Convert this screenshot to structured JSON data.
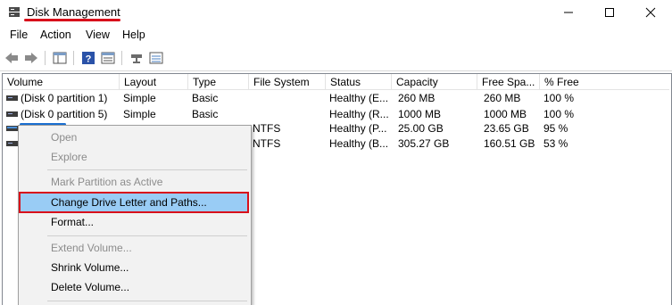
{
  "window": {
    "title": "Disk Management",
    "icon": "disk-management-icon",
    "controls": [
      "minimize-icon",
      "maximize-icon",
      "close-icon"
    ]
  },
  "menu": [
    "File",
    "Action",
    "View",
    "Help"
  ],
  "toolbar": [
    "back-arrow-icon",
    "forward-arrow-icon",
    "console-view-icon",
    "help-icon",
    "properties-view-icon",
    "connect-icon",
    "list-view-icon"
  ],
  "table": {
    "columns": [
      "Volume",
      "Layout",
      "Type",
      "File System",
      "Status",
      "Capacity",
      "Free Spa...",
      "% Free"
    ],
    "rows": [
      {
        "volume": "(Disk 0 partition 1)",
        "layout": "Simple",
        "type": "Basic",
        "fs": "",
        "status": "Healthy (E...",
        "capacity": "260 MB",
        "free": "260 MB",
        "pct": "100 %"
      },
      {
        "volume": "(Disk 0 partition 5)",
        "layout": "Simple",
        "type": "Basic",
        "fs": "",
        "status": "Healthy (R...",
        "capacity": "1000 MB",
        "free": "1000 MB",
        "pct": "100 %"
      },
      {
        "volume": "",
        "layout": "",
        "type": "",
        "fs": "NTFS",
        "status": "Healthy (P...",
        "capacity": "25.00 GB",
        "free": "23.65 GB",
        "pct": "95 %"
      },
      {
        "volume": "",
        "layout": "",
        "type": "",
        "fs": "NTFS",
        "status": "Healthy (B...",
        "capacity": "305.27 GB",
        "free": "160.51 GB",
        "pct": "53 %"
      }
    ]
  },
  "context_menu": {
    "items": [
      {
        "label": "Open",
        "enabled": false
      },
      {
        "label": "Explore",
        "enabled": false
      },
      {
        "label": "Mark Partition as Active",
        "enabled": false
      },
      {
        "label": "Change Drive Letter and Paths...",
        "enabled": true,
        "highlighted": true
      },
      {
        "label": "Format...",
        "enabled": true
      },
      {
        "label": "Extend Volume...",
        "enabled": false
      },
      {
        "label": "Shrink Volume...",
        "enabled": true
      },
      {
        "label": "Delete Volume...",
        "enabled": true
      }
    ]
  },
  "colors": {
    "annotation_red": "#d8101b",
    "annotation_blue": "#1a6fd1",
    "highlight": "#99ccf5"
  }
}
